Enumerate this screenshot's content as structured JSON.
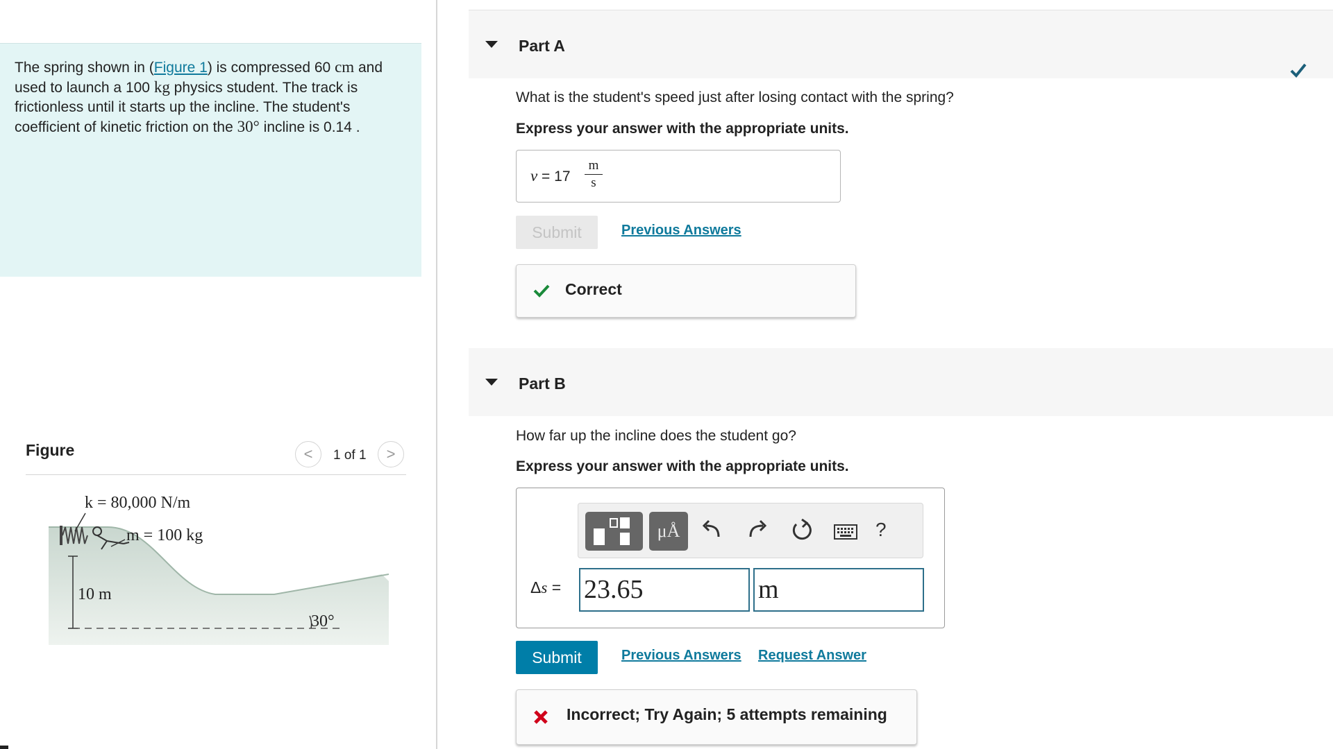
{
  "problem": {
    "t1": "The spring shown in (",
    "figure_link": "Figure 1",
    "t2": ") is compressed 60 ",
    "u_cm": "cm",
    "t3": " and used to launch a 100 ",
    "u_kg": "kg",
    "t4": " physics student. The track is frictionless until it starts up the incline. The student's coefficient of kinetic friction on the ",
    "angle": "30°",
    "t5": " incline is 0.14 ."
  },
  "figure": {
    "title": "Figure",
    "prev_symbol": "<",
    "next_symbol": ">",
    "count": "1 of 1",
    "k_label": "k = 80,000 N/m",
    "m_label": "m = 100 kg",
    "h_label": "10 m",
    "angle_label": "30°"
  },
  "part_a": {
    "title": "Part A",
    "question": "What is the student's speed just after losing contact with the spring?",
    "instruction": "Express your answer with the appropriate units.",
    "answer_var": "v",
    "answer_eq": " =  17",
    "unit_num": "m",
    "unit_den": "s",
    "submit_label": "Submit",
    "prev_answers_label": "Previous Answers",
    "feedback": "Correct"
  },
  "part_b": {
    "title": "Part B",
    "question": "How far up the incline does the student go?",
    "instruction": "Express your answer with the appropriate units.",
    "toolbar_units_label": "μÅ",
    "help_label": "?",
    "delta_label": "Δ",
    "var_label": "s",
    "eq_label": " =",
    "value": "23.65",
    "unit": "m",
    "submit_label": "Submit",
    "prev_answers_label": "Previous Answers",
    "request_answer_label": "Request Answer",
    "feedback": "Incorrect; Try Again; 5 attempts remaining"
  },
  "colors": {
    "problem_bg": "#e3f5f5",
    "link": "#0f7a9c",
    "submit_active": "#007ea8",
    "correct_green": "#1a8a3a",
    "incorrect_red": "#d0021b",
    "done_check": "#1c5f7a"
  },
  "icons": [
    "template-icon",
    "units-icon",
    "undo-icon",
    "redo-icon",
    "reset-icon",
    "keyboard-icon",
    "help-icon",
    "checkmark-icon",
    "x-icon",
    "collapse-triangle-icon"
  ]
}
